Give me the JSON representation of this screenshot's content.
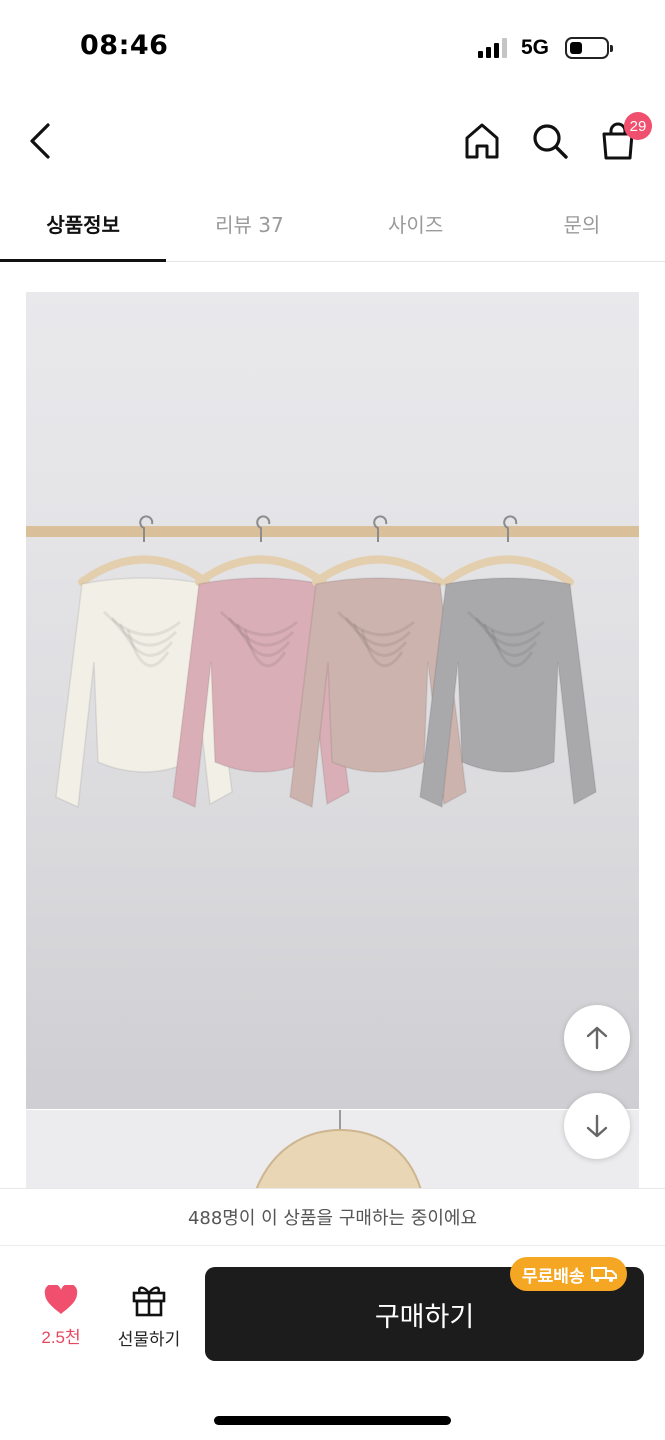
{
  "status_bar": {
    "time": "08:46",
    "network": "5G",
    "battery_level": 0.35,
    "signal_bars_active": 3,
    "signal_bars_total": 4
  },
  "nav": {
    "back_icon": "chevron-left-icon",
    "home_icon": "home-icon",
    "search_icon": "search-icon",
    "cart_icon": "shopping-bag-icon",
    "cart_count": "29"
  },
  "tabs": [
    {
      "label": "상품정보",
      "active": true
    },
    {
      "label": "리뷰 37",
      "active": false
    },
    {
      "label": "사이즈",
      "active": false
    },
    {
      "label": "문의",
      "active": false
    }
  ],
  "product": {
    "colors": [
      "#f2efe6",
      "#d9aeb6",
      "#cdb3ad",
      "#a9a9ab"
    ]
  },
  "scroll": {
    "up_icon": "arrow-up-icon",
    "down_icon": "arrow-down-icon"
  },
  "buyers_text": "488명이 이 상품을 구매하는 중이에요",
  "actions": {
    "like_count": "2.5천",
    "gift_label": "선물하기",
    "buy_label": "구매하기",
    "free_shipping_label": "무료배송",
    "like_color": "#f0506e",
    "badge_color": "#f5a623"
  }
}
